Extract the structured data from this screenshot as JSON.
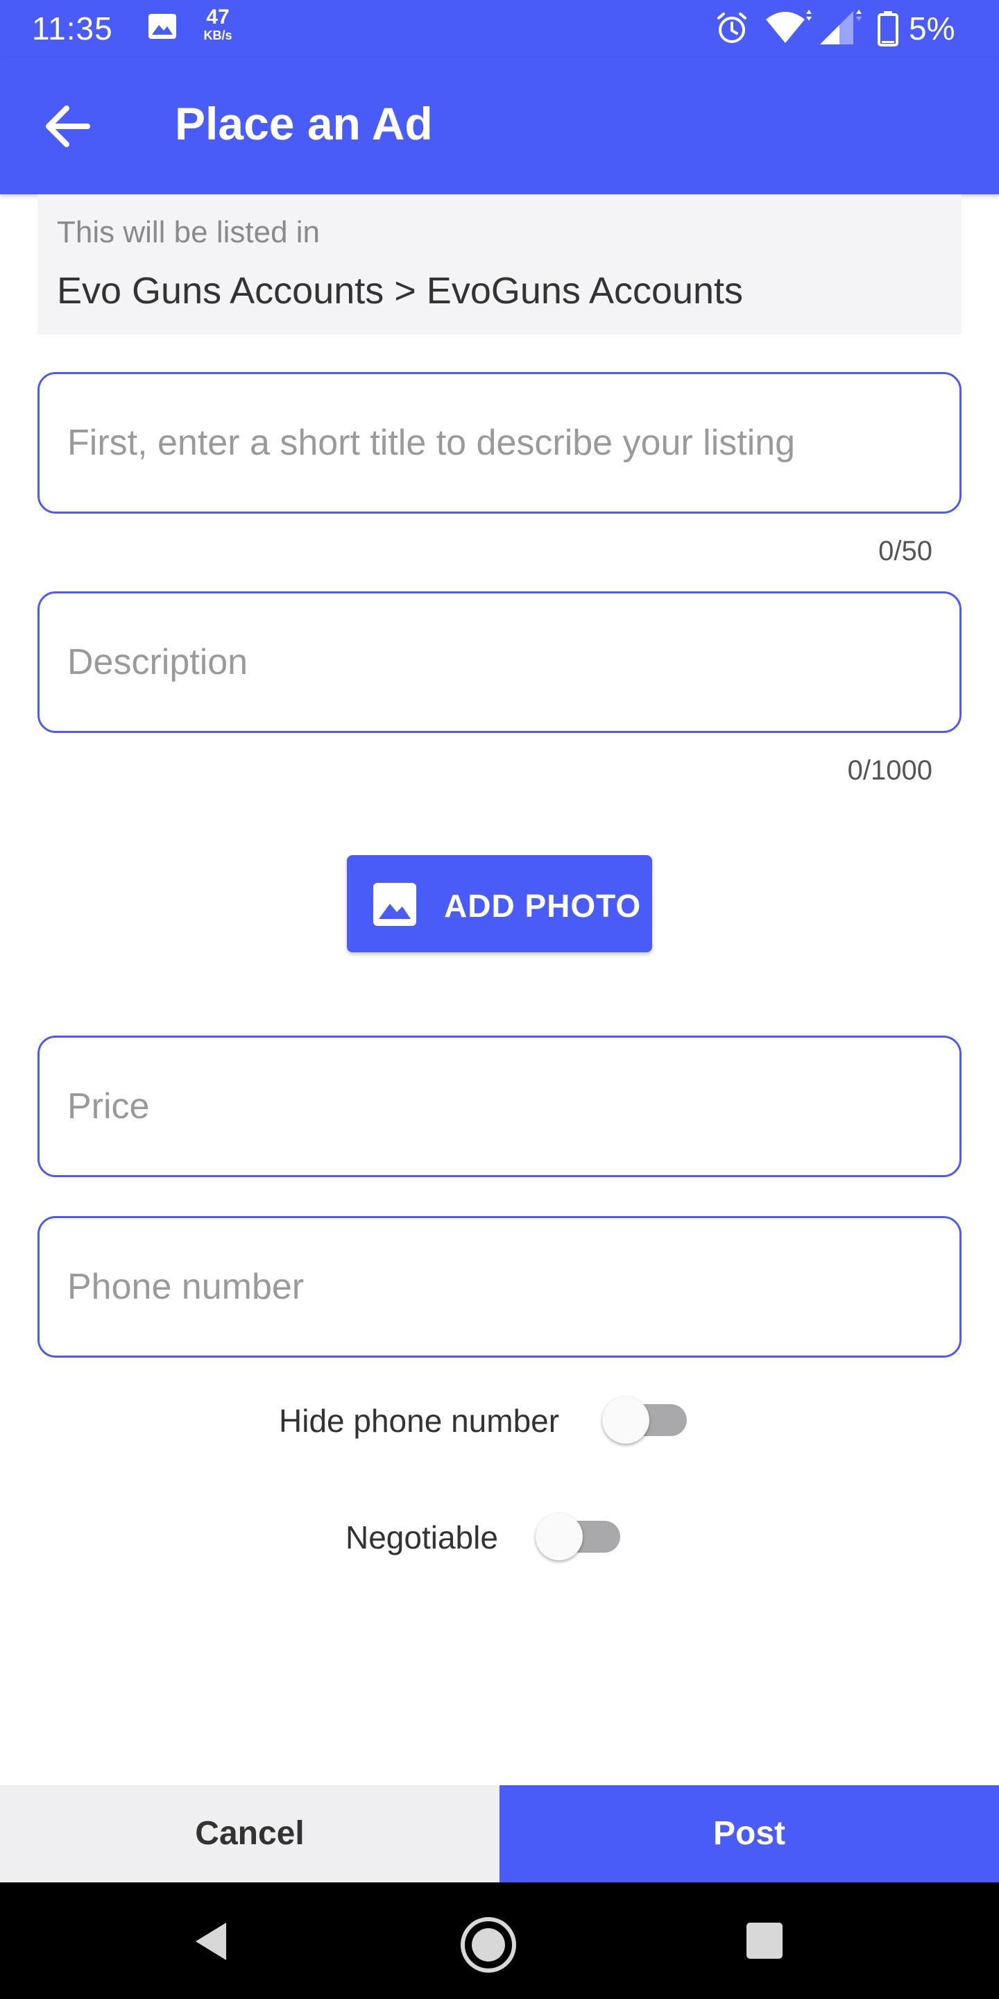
{
  "status_bar": {
    "time": "11:35",
    "net_speed_value": "47",
    "net_speed_unit": "KB/s",
    "battery_percent": "5%",
    "icons": [
      "gallery-icon",
      "alarm-icon",
      "wifi-icon",
      "cell-signal-icon",
      "battery-icon"
    ]
  },
  "app_bar": {
    "title": "Place an Ad",
    "back_icon": "arrow-left-icon"
  },
  "listing": {
    "label": "This will be listed in",
    "path": "Evo Guns Accounts > EvoGuns Accounts"
  },
  "form": {
    "title": {
      "value": "",
      "placeholder": "First, enter a short title to describe your listing",
      "counter": "0/50"
    },
    "description": {
      "value": "",
      "placeholder": "Description",
      "counter": "0/1000"
    },
    "add_photo": {
      "label": "ADD PHOTO",
      "icon": "image-icon"
    },
    "price": {
      "value": "",
      "placeholder": "Price"
    },
    "phone": {
      "value": "",
      "placeholder": "Phone number"
    },
    "hide_phone": {
      "label": "Hide phone number",
      "enabled": false
    },
    "negotiable": {
      "label": "Negotiable",
      "enabled": false
    }
  },
  "actions": {
    "cancel_label": "Cancel",
    "post_label": "Post"
  },
  "colors": {
    "brand": "#4a5cf7",
    "toggle_off_track": "#a9a9ab",
    "listed_bg": "#f4f4f6",
    "cancel_bg": "#efeff1"
  },
  "nav_bar": {
    "icons": [
      "nav-back-icon",
      "nav-home-icon",
      "nav-recents-icon"
    ]
  }
}
